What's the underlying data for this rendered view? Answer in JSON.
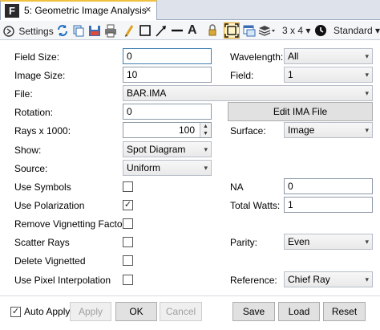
{
  "tab": {
    "icon": "F",
    "title": "5: Geometric Image Analysis",
    "close": "×"
  },
  "toolbar": {
    "settings_label": "Settings",
    "layout_label": "3 x 4",
    "layout_arrow": "▾",
    "standard_label": "Standard",
    "standard_arrow": "▾",
    "text_tool": "A",
    "icons": [
      "settings-icon",
      "refresh-icon",
      "copy-icon",
      "save-icon",
      "print-icon",
      "pencil-icon",
      "rectangle-icon",
      "arrow-icon",
      "line-icon",
      "text-icon",
      "lock-icon",
      "fit-icon",
      "window-icon",
      "layers-icon",
      "clock-icon"
    ]
  },
  "form": {
    "field_size": {
      "label": "Field Size:",
      "value": "0"
    },
    "image_size": {
      "label": "Image Size:",
      "value": "10"
    },
    "file": {
      "label": "File:",
      "value": "BAR.IMA"
    },
    "rotation": {
      "label": "Rotation:",
      "value": "0"
    },
    "rays": {
      "label": "Rays x 1000:",
      "value": "100"
    },
    "show": {
      "label": "Show:",
      "value": "Spot Diagram"
    },
    "source": {
      "label": "Source:",
      "value": "Uniform"
    },
    "use_symbols": {
      "label": "Use Symbols",
      "checked": false
    },
    "use_polarization": {
      "label": "Use Polarization",
      "checked": true
    },
    "remove_vignetting": {
      "label": "Remove Vignetting Factors",
      "checked": false
    },
    "scatter_rays": {
      "label": "Scatter Rays",
      "checked": false
    },
    "delete_vignetted": {
      "label": "Delete Vignetted",
      "checked": false
    },
    "pixel_interp": {
      "label": "Use Pixel Interpolation",
      "checked": false
    },
    "wavelength": {
      "label": "Wavelength:",
      "value": "All"
    },
    "field": {
      "label": "Field:",
      "value": "1"
    },
    "edit_ima_button": "Edit IMA File",
    "surface": {
      "label": "Surface:",
      "value": "Image"
    },
    "na": {
      "label": "NA",
      "value": "0"
    },
    "total_watts": {
      "label": "Total Watts:",
      "value": "1"
    },
    "parity": {
      "label": "Parity:",
      "value": "Even"
    },
    "reference": {
      "label": "Reference:",
      "value": "Chief Ray"
    }
  },
  "buttons": {
    "auto_apply": {
      "label": "Auto Apply",
      "checked": true
    },
    "apply": "Apply",
    "ok": "OK",
    "cancel": "Cancel",
    "save": "Save",
    "load": "Load",
    "reset": "Reset"
  },
  "glyphs": {
    "check": "✓",
    "dropdown": "▾",
    "spin_up": "▲",
    "spin_down": "▼"
  }
}
